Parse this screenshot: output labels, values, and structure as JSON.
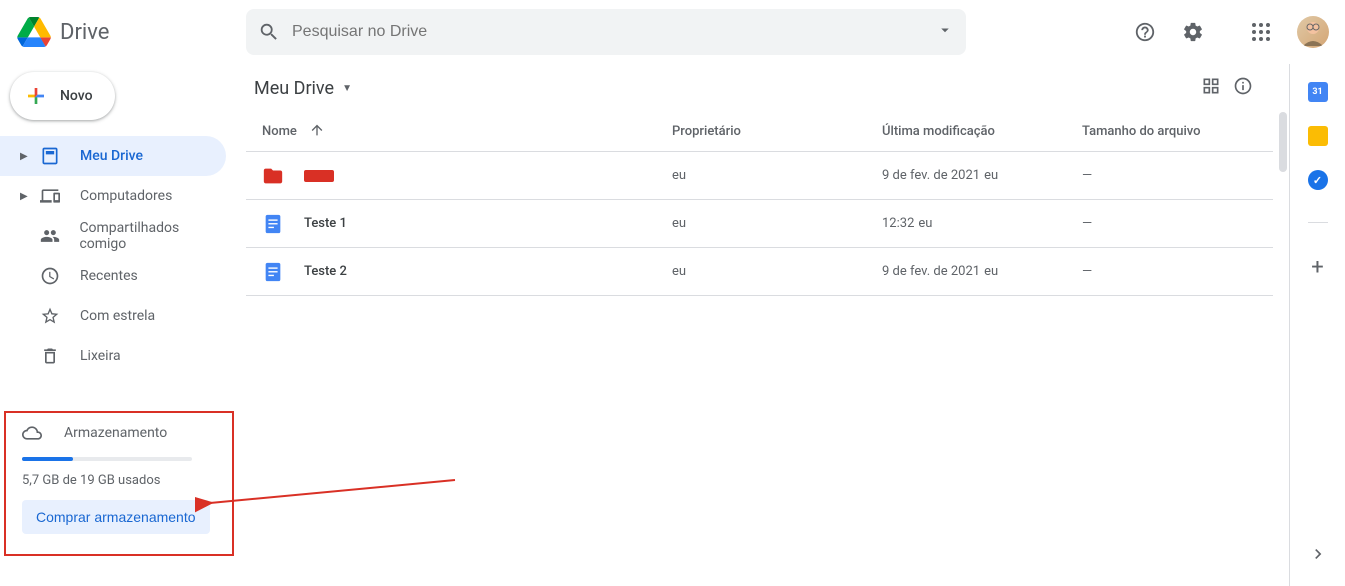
{
  "header": {
    "app_title": "Drive",
    "search_placeholder": "Pesquisar no Drive"
  },
  "sidebar": {
    "new_label": "Novo",
    "items": [
      {
        "label": "Meu Drive"
      },
      {
        "label": "Computadores"
      },
      {
        "label": "Compartilhados comigo"
      },
      {
        "label": "Recentes"
      },
      {
        "label": "Com estrela"
      },
      {
        "label": "Lixeira"
      }
    ],
    "storage": {
      "label": "Armazenamento",
      "usage_text": "5,7 GB de 19 GB usados",
      "percent": 30,
      "buy_label": "Comprar armazenamento"
    }
  },
  "breadcrumb": {
    "title": "Meu Drive"
  },
  "columns": {
    "name": "Nome",
    "owner": "Proprietário",
    "modified": "Última modificação",
    "size": "Tamanho do arquivo"
  },
  "files": [
    {
      "name_redacted": true,
      "owner": "eu",
      "modified": "9 de fev. de 2021",
      "modified_by": "eu",
      "size": "—",
      "icon": "folder-red"
    },
    {
      "name": "Teste 1",
      "owner": "eu",
      "modified": "12:32",
      "modified_by": "eu",
      "size": "—",
      "icon": "doc"
    },
    {
      "name": "Teste 2",
      "owner": "eu",
      "modified": "9 de fev. de 2021",
      "modified_by": "eu",
      "size": "—",
      "icon": "doc"
    }
  ]
}
